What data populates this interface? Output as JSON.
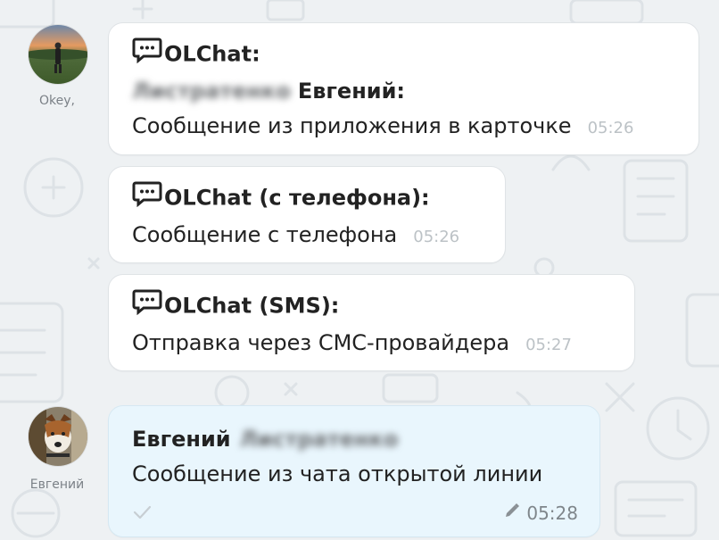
{
  "messages": [
    {
      "author": "Okey,",
      "header_prefix": "OLChat:",
      "sender_blurred": "Листратенко",
      "sender_name": "Евгений:",
      "text": "Сообщение из приложения в карточке",
      "time": "05:26",
      "icon": "chat-bubble-icon"
    },
    {
      "header_prefix": "OLChat (с телефона):",
      "text": "Сообщение с телефона",
      "time": "05:26",
      "icon": "chat-bubble-icon"
    },
    {
      "header_prefix": "OLChat (SMS):",
      "text": "Отправка через СМС-провайдера",
      "time": "05:27",
      "icon": "chat-bubble-icon"
    },
    {
      "author": "Евгений",
      "sender_name": "Евгений",
      "sender_blurred": "Листратенко",
      "text": "Сообщение из чата открытой линии",
      "time": "05:28",
      "edited_icon": "pencil-icon",
      "status_icon": "check-icon"
    }
  ],
  "colors": {
    "background": "#eef1f3",
    "incoming_bubble": "#ffffff",
    "outgoing_bubble": "#e9f6fd",
    "text": "#222222",
    "time": "#bcc2c6"
  }
}
